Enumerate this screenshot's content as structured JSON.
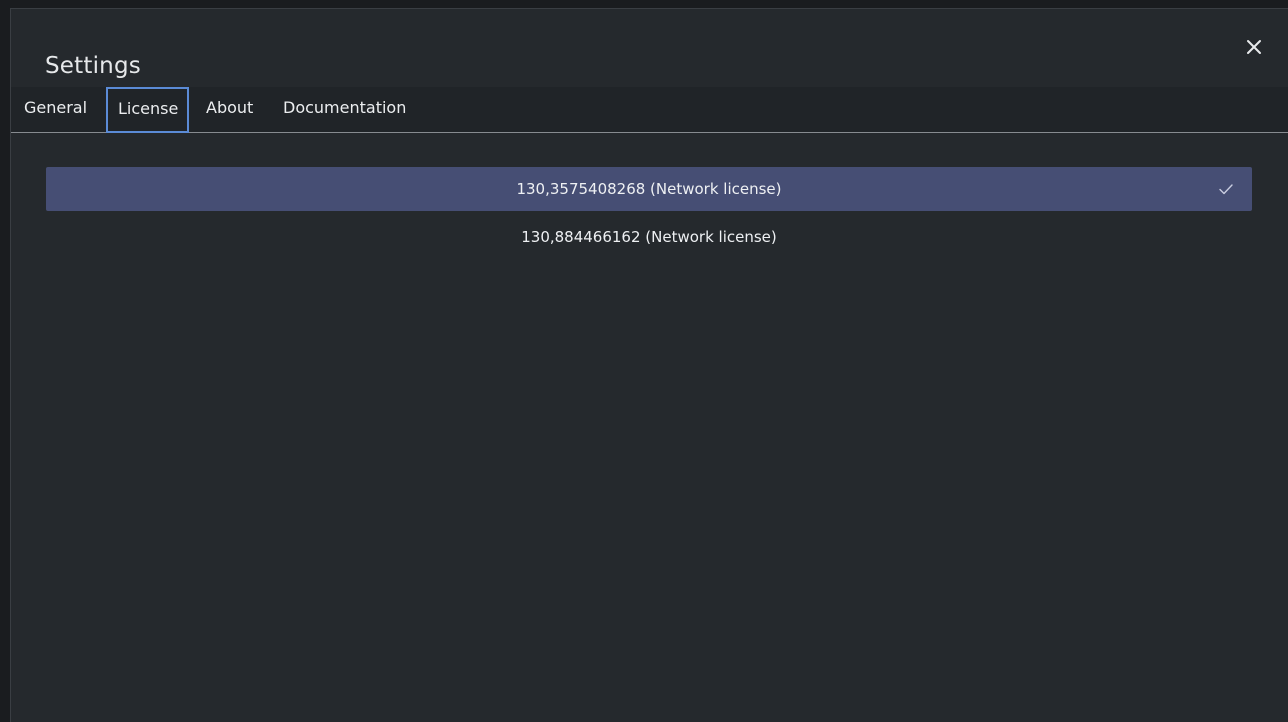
{
  "dialog": {
    "title": "Settings",
    "close_icon": "close-icon"
  },
  "tabs": [
    {
      "label": "General",
      "active": false
    },
    {
      "label": "License",
      "active": true
    },
    {
      "label": "About",
      "active": false
    },
    {
      "label": "Documentation",
      "active": false
    }
  ],
  "licenses": [
    {
      "label": "130,3575408268 (Network license)",
      "selected": true,
      "icon": "check-icon"
    },
    {
      "label": "130,884466162 (Network license)",
      "selected": false
    }
  ],
  "colors": {
    "background": "#25292d",
    "tab_bar": "#202428",
    "selected_row": "#464e74",
    "active_tab_border": "#5b8bd6",
    "text": "#eef0f3"
  }
}
